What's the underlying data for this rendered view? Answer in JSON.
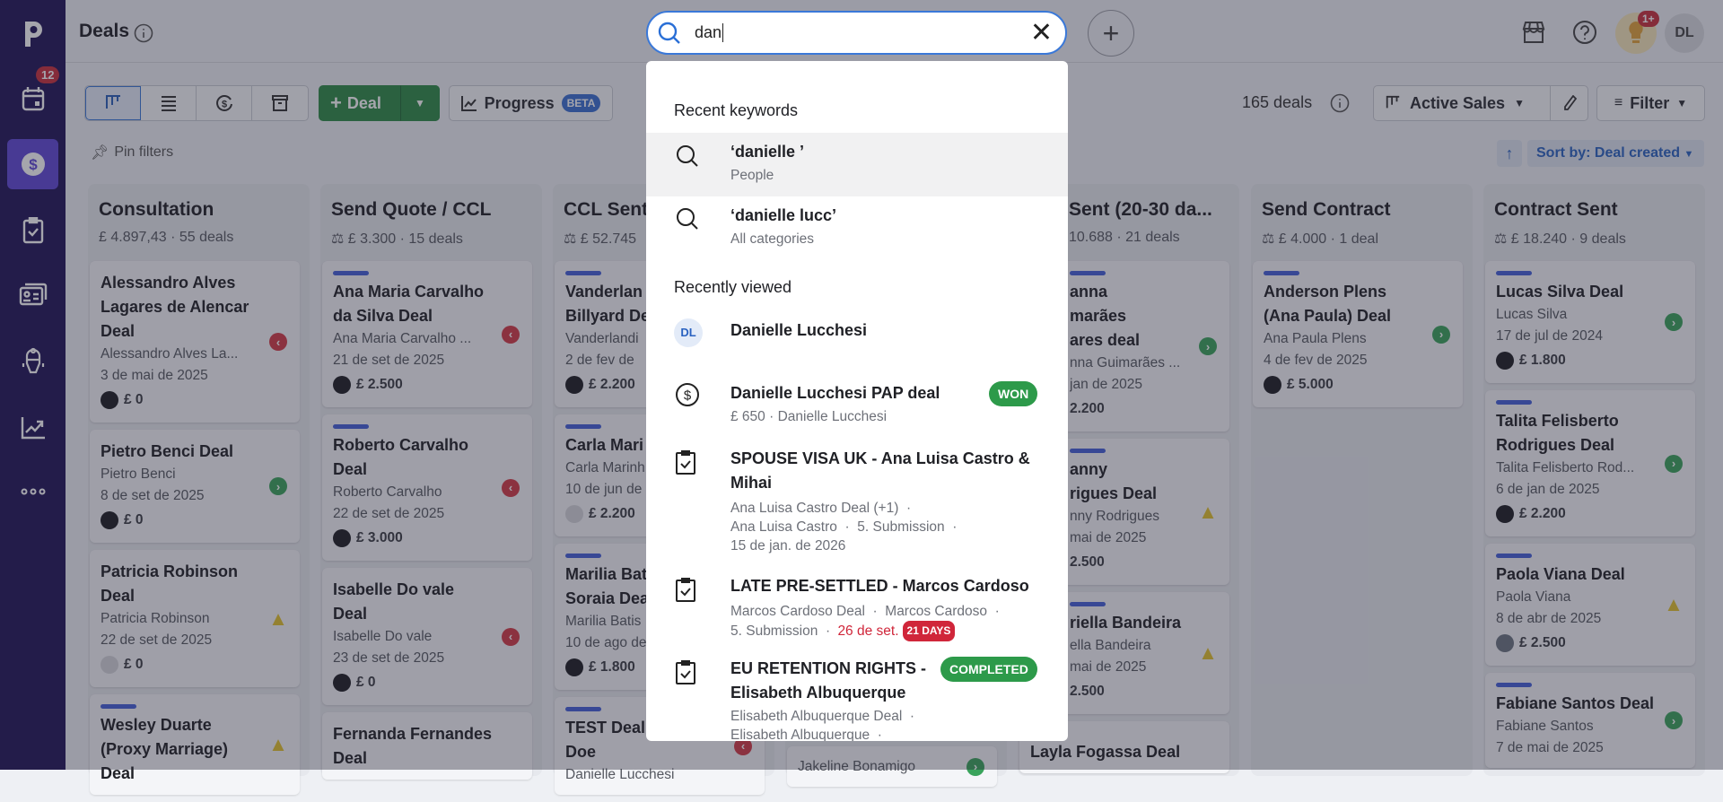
{
  "sidebar": {
    "calendar_badge": "12",
    "items": [
      "logo",
      "activities",
      "deals",
      "tasks",
      "contacts",
      "automations",
      "insights",
      "more"
    ]
  },
  "header": {
    "title": "Deals",
    "search_value": "dan",
    "avatar": "DL",
    "notif_badge": "1+"
  },
  "toolbar": {
    "add_deal": "Deal",
    "progress": "Progress",
    "beta": "BETA",
    "deal_count": "165 deals",
    "pipeline": "Active Sales",
    "filter": "Filter",
    "pin_filters": "Pin filters",
    "sort": "Sort by: Deal created"
  },
  "columns": [
    {
      "title": "Consultation",
      "sub": "£ 4.897,43 · 55 deals",
      "scale": false,
      "cards": [
        {
          "bar": false,
          "title": "Alessandro Alves Lagares de Alencar Deal",
          "person": "Alessandro Alves La...",
          "date": "3 de mai de 2025",
          "value": "£ 0",
          "status": "left",
          "avatar": "dark"
        },
        {
          "bar": false,
          "title": "Pietro Benci Deal",
          "person": "Pietro Benci",
          "date": "8 de set de 2025",
          "value": "£ 0",
          "status": "right",
          "avatar": "dark"
        },
        {
          "bar": false,
          "title": "Patricia Robinson Deal",
          "person": "Patricia Robinson",
          "date": "22 de set de 2025",
          "value": "£ 0",
          "status": "warn",
          "avatar": "light"
        },
        {
          "bar": true,
          "title": "Wesley Duarte (Proxy Marriage) Deal",
          "person": "",
          "date": "",
          "value": "",
          "status": "warn",
          "avatar": ""
        }
      ]
    },
    {
      "title": "Send Quote / CCL",
      "sub": "£ 3.300 · 15 deals",
      "scale": true,
      "cards": [
        {
          "bar": true,
          "title": "Ana Maria Carvalho da Silva Deal",
          "person": "Ana Maria Carvalho ...",
          "date": "21 de set de 2025",
          "value": "£ 2.500",
          "status": "left",
          "avatar": "dark"
        },
        {
          "bar": true,
          "title": "Roberto Carvalho Deal",
          "person": "Roberto Carvalho",
          "date": "22 de set de 2025",
          "value": "£ 3.000",
          "status": "left",
          "avatar": "dark"
        },
        {
          "bar": false,
          "title": "Isabelle Do vale Deal",
          "person": "Isabelle Do vale",
          "date": "23 de set de 2025",
          "value": "£ 0",
          "status": "left",
          "avatar": "dark"
        },
        {
          "bar": false,
          "title": "Fernanda Fernandes Deal",
          "person": "",
          "date": "",
          "value": "",
          "status": "",
          "avatar": ""
        }
      ]
    },
    {
      "title": "CCL Sent",
      "sub": "£ 52.745",
      "scale": true,
      "cards": [
        {
          "bar": true,
          "title": "Vanderlan\nBillyard De",
          "person": "Vanderlandi",
          "date": "2 de fev de",
          "value": "£ 2.200",
          "status": "",
          "avatar": "dark"
        },
        {
          "bar": true,
          "title": "Carla Mari",
          "person": "Carla Marinh",
          "date": "10 de jun de",
          "value": "£ 2.200",
          "status": "",
          "avatar": "light"
        },
        {
          "bar": true,
          "title": "Marilia Bat\nSoraia Dea",
          "person": "Marilia Batis",
          "date": "10 de ago de",
          "value": "£ 1.800",
          "status": "",
          "avatar": "dark"
        },
        {
          "bar": true,
          "title": "TEST Deal\nDoe",
          "person": "Danielle Lucchesi",
          "date": "",
          "value": "",
          "status": "left",
          "avatar": ""
        }
      ]
    },
    {
      "title": "",
      "sub": "",
      "scale": false,
      "cards": [
        {
          "bar": false,
          "title": "",
          "person": "Jakeline Bonamigo",
          "date": "",
          "value": "",
          "status": "right",
          "avatar": ""
        }
      ]
    },
    {
      "title": "Sent (20-30 da...",
      "sub": "10.688 · 21 deals",
      "scale": false,
      "clip": true,
      "cards": [
        {
          "bar": true,
          "title": "anna\nmarães\nares deal",
          "person": "nna Guimarães ...",
          "date": "jan de 2025",
          "value": "2.200",
          "status": "right",
          "avatar": "",
          "clip": true
        },
        {
          "bar": true,
          "title": "anny\nrigues Deal",
          "person": "nny Rodrigues",
          "date": "mai de 2025",
          "value": "2.500",
          "status": "warn",
          "avatar": "",
          "clip": true
        },
        {
          "bar": true,
          "title": "riella Bandeira\n ",
          "person": "ella Bandeira",
          "date": "mai de 2025",
          "value": "2.500",
          "status": "warn",
          "avatar": "",
          "clip": true
        },
        {
          "bar": true,
          "title": "Layla Fogassa Deal",
          "person": "",
          "date": "",
          "value": "",
          "status": "",
          "avatar": ""
        }
      ]
    },
    {
      "title": "Send Contract",
      "sub": "£ 4.000 · 1 deal",
      "scale": true,
      "cards": [
        {
          "bar": true,
          "title": "Anderson Plens (Ana Paula) Deal",
          "person": "Ana Paula Plens",
          "date": "4 de fev de 2025",
          "value": "£ 5.000",
          "status": "right",
          "avatar": "dark"
        }
      ]
    },
    {
      "title": "Contract Sent",
      "sub": "£ 18.240 · 9 deals",
      "scale": true,
      "cards": [
        {
          "bar": true,
          "title": "Lucas Silva Deal",
          "person": "Lucas Silva",
          "date": "17 de jul de 2024",
          "value": "£ 1.800",
          "status": "right",
          "avatar": "dark"
        },
        {
          "bar": true,
          "title": "Talita Felisberto Rodrigues Deal",
          "person": "Talita Felisberto Rod...",
          "date": "6 de jan de 2025",
          "value": "£ 2.200",
          "status": "right",
          "avatar": "dark"
        },
        {
          "bar": true,
          "title": "Paola Viana Deal",
          "person": "Paola Viana",
          "date": "8 de abr de 2025",
          "value": "£ 2.500",
          "status": "warn",
          "avatar": "photo"
        },
        {
          "bar": true,
          "title": "Fabiane Santos Deal",
          "person": "Fabiane Santos",
          "date": "7 de mai de 2025",
          "value": "",
          "status": "right",
          "avatar": ""
        }
      ]
    }
  ],
  "search": {
    "recent_keywords_label": "Recent keywords",
    "keywords": [
      {
        "text": "‘danielle ’",
        "category": "People"
      },
      {
        "text": "‘danielle lucc’",
        "category": "All categories"
      }
    ],
    "recently_viewed_label": "Recently viewed",
    "person": {
      "initials": "DL",
      "name": "Danielle Lucchesi"
    },
    "deal": {
      "title": "Danielle Lucchesi PAP deal",
      "value": "£ 650",
      "sep": "·",
      "person": "Danielle Lucchesi",
      "badge": "WON"
    },
    "tasks": [
      {
        "title": "SPOUSE VISA UK - Ana Luisa Castro & Mihai",
        "line1": "Ana Luisa Castro Deal (+1)  ·",
        "line2": "Ana Luisa Castro  ·  5. Submission  ·",
        "line3": "15 de jan. de 2026"
      },
      {
        "title": "LATE PRE-SETTLED - Marcos Cardoso",
        "line1": "Marcos Cardoso Deal  ·  Marcos Cardoso  ·",
        "line2": "5. Submission  · ",
        "due": "26 de set.",
        "overdue": "21 DAYS"
      },
      {
        "title": "EU RETENTION RIGHTS - Elisabeth Albuquerque",
        "line1": "Elisabeth Albuquerque Deal  ·",
        "line2": "Elisabeth Albuquerque  ·",
        "badge": "COMPLETED"
      }
    ]
  },
  "colors": {
    "accent": "#3a78d8",
    "won": "#2d9a4a",
    "sidebar": "#1f1456",
    "active": "#5f48d6",
    "overdue": "#d0263a"
  }
}
